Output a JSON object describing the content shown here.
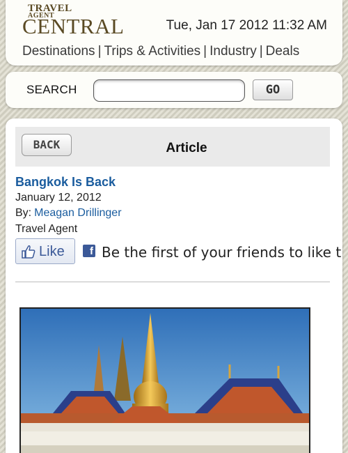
{
  "logo": {
    "line1": "TRAVEL",
    "line2": "AGENT",
    "line3": "CENTRAL"
  },
  "datetime": "Tue, Jan 17 2012 11:32 AM",
  "nav": {
    "items": [
      "Destinations",
      "Trips & Activities",
      "Industry",
      "Deals"
    ],
    "separator": "|"
  },
  "search": {
    "label": "SEARCH",
    "value": "",
    "go_label": "GO"
  },
  "title_bar": {
    "back_label": "BACK",
    "title": "Article"
  },
  "article": {
    "headline": "Bangkok Is Back",
    "date": "January 12, 2012",
    "by_prefix": "By:",
    "author": "Meagan Drillinger",
    "publication": "Travel Agent"
  },
  "social": {
    "like_label": "Like",
    "fb_glyph": "f",
    "prompt": "Be the first of your friends to like this."
  },
  "colors": {
    "link": "#1a5c9e",
    "facebook": "#3b5998",
    "logo": "#5a4a24",
    "background": "#d8d6c9"
  },
  "icons": {
    "like": "thumbs-up-icon",
    "facebook": "facebook-icon"
  }
}
